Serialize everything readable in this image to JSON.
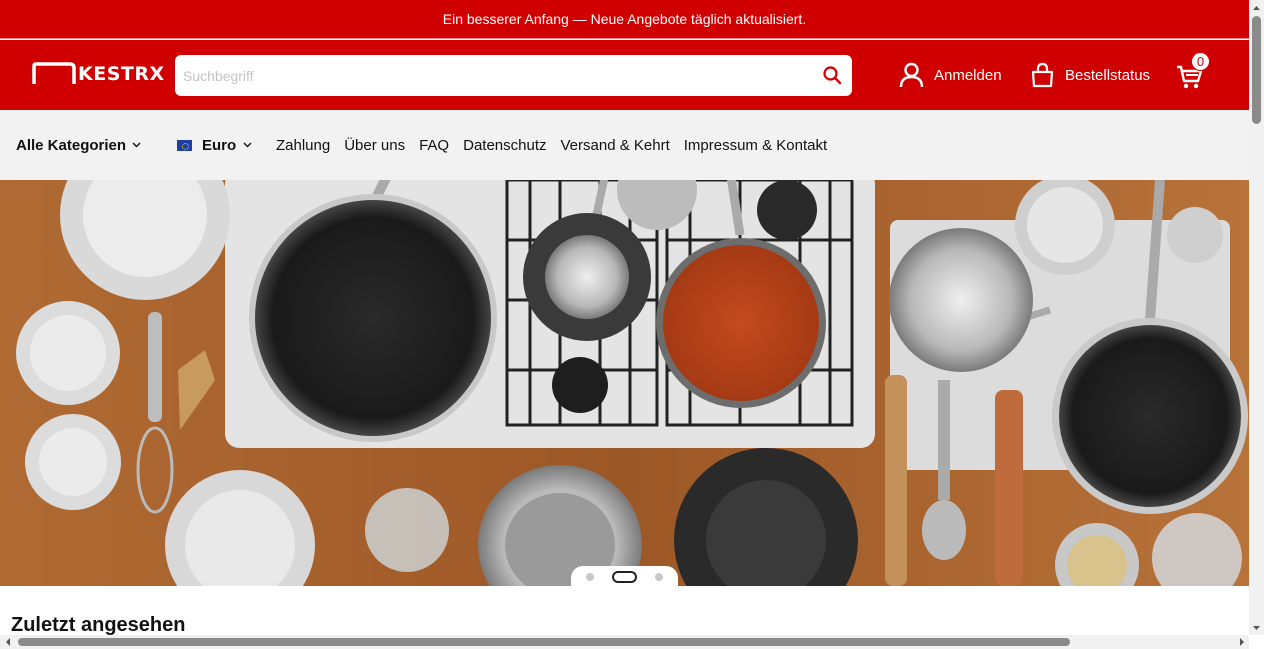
{
  "promo": {
    "text": "Ein besserer Anfang — Neue Angebote täglich aktualisiert."
  },
  "header": {
    "logo_text": "KESTRX",
    "search_placeholder": "Suchbegriff",
    "search_value": "",
    "search_icon": "search-icon",
    "login_label": "Anmelden",
    "login_icon": "user-icon",
    "order_status_label": "Bestellstatus",
    "order_status_icon": "shopping-bag-icon",
    "cart_icon": "cart-icon",
    "cart_count": "0"
  },
  "nav": {
    "categories_label": "Alle Kategorien",
    "currency_label": "Euro",
    "links": [
      "Zahlung",
      "Über uns",
      "FAQ",
      "Datenschutz",
      "Versand & Kehrt",
      "Impressum & Kontakt"
    ]
  },
  "hero": {
    "slide_count": 3,
    "active_slide": 2
  },
  "section": {
    "recently_viewed_title": "Zuletzt angesehen"
  },
  "colors": {
    "brand_red": "#d10000",
    "nav_bg": "#f2f2f2",
    "white": "#ffffff"
  }
}
